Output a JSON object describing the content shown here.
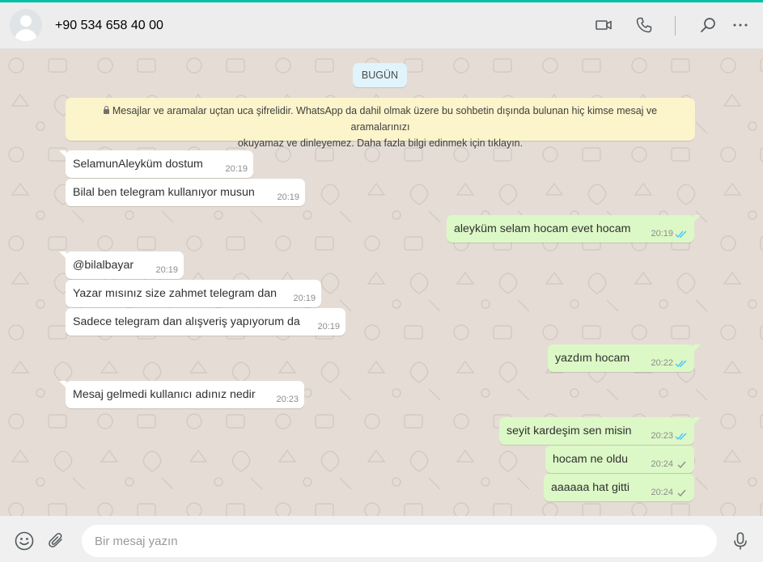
{
  "header": {
    "contact_name": "+90 534 658 40 00",
    "icons": [
      "avatar",
      "video-call-icon",
      "voice-call-icon",
      "search-icon",
      "menu-icon"
    ]
  },
  "chat": {
    "date_label": "BUGÜN",
    "encryption_notice_line1": "Mesajlar ve aramalar uçtan uca şifrelidir. WhatsApp da dahil olmak üzere bu sohbetin dışında bulunan hiç kimse mesaj ve aramalarınızı",
    "encryption_notice_line2": "okuyamaz ve dinleyemez. Daha fazla bilgi edinmek için tıklayın.",
    "messages": [
      {
        "dir": "in",
        "text": "SelamunAleyküm dostum",
        "time": "20:19"
      },
      {
        "dir": "in",
        "text": "Bilal ben telegram kullanıyor musun",
        "time": "20:19"
      },
      {
        "dir": "out",
        "text": "aleyküm selam hocam evet hocam",
        "time": "20:19",
        "status": "read"
      },
      {
        "dir": "in",
        "text": "@bilalbayar",
        "time": "20:19"
      },
      {
        "dir": "in",
        "text": "Yazar mısınız size zahmet telegram dan",
        "time": "20:19"
      },
      {
        "dir": "in",
        "text": "Sadece telegram dan alışveriş yapıyorum da",
        "time": "20:19"
      },
      {
        "dir": "out",
        "text": "yazdım hocam",
        "time": "20:22",
        "status": "read"
      },
      {
        "dir": "in",
        "text": "Mesaj gelmedi kullanıcı adınız nedir",
        "time": "20:23"
      },
      {
        "dir": "out",
        "text": "seyit kardeşim sen misin",
        "time": "20:23",
        "status": "read"
      },
      {
        "dir": "out",
        "text": "hocam ne oldu",
        "time": "20:24",
        "status": "sent"
      },
      {
        "dir": "out",
        "text": "aaaaaa hat gitti",
        "time": "20:24",
        "status": "sent"
      }
    ]
  },
  "footer": {
    "placeholder": "Bir mesaj yazın",
    "icons": [
      "emoji-icon",
      "attach-icon",
      "microphone-icon"
    ]
  },
  "colors": {
    "accent": "#00bfa5",
    "read_ticks": "#4fc3f7",
    "sent_ticks": "#8c8c8c",
    "incoming_bubble": "#ffffff",
    "outgoing_bubble": "#dcf8c6",
    "notice_bg": "#fcf4cb",
    "chat_bg": "#e5ddd5"
  }
}
